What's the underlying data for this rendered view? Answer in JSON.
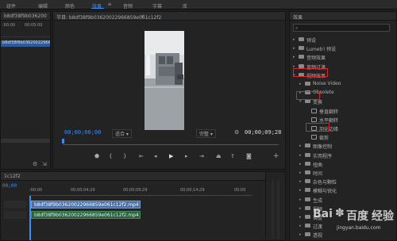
{
  "menu": {
    "items": [
      "组件",
      "编辑",
      "颜色",
      "效果",
      "音频",
      "字幕",
      "库"
    ],
    "active_index": 3
  },
  "project_panel": {
    "title": "b8df38f9b036200",
    "ruler_start": ":00:00",
    "ruler_end": "00:05:00",
    "clip_name": "b8df38f9b03620022966859e061c12f2.mp4"
  },
  "program": {
    "title": "节目: b8df38f9b03620022966859e061c12f2",
    "timecode_left": "00;00;00;00",
    "fit_label": "适合",
    "resolution_label": "完整",
    "timecode_right": "00;00;09;28"
  },
  "timeline": {
    "seq_name": "1c12f2",
    "timecode": "00;00",
    "ruler_labels": [
      ":00;00",
      "00;00;04;29",
      "00;00;09;29",
      "00;00;14;29",
      "00;00"
    ],
    "clip_name": "b8df38f9b03620022966859e061c12f2.mp4 [V]",
    "audio_clip_name": "b8df38f9b03620022966859e061c12f2.mp4"
  },
  "effects_panel": {
    "title": "效果",
    "search_placeholder": "",
    "items": [
      {
        "label": "预设",
        "indent": 0,
        "type": "folder",
        "expanded": false
      },
      {
        "label": "Lumetri 预设",
        "indent": 0,
        "type": "folder",
        "expanded": false
      },
      {
        "label": "音频效果",
        "indent": 0,
        "type": "folder",
        "expanded": false
      },
      {
        "label": "音频过渡",
        "indent": 0,
        "type": "folder",
        "expanded": false
      },
      {
        "label": "视频效果",
        "indent": 0,
        "type": "folder",
        "expanded": true
      },
      {
        "label": "Noise Video",
        "indent": 1,
        "type": "folder",
        "expanded": false
      },
      {
        "label": "Obsolete",
        "indent": 1,
        "type": "folder",
        "expanded": false
      },
      {
        "label": "变换",
        "indent": 1,
        "type": "folder",
        "expanded": true
      },
      {
        "label": "垂直翻转",
        "indent": 2,
        "type": "effect"
      },
      {
        "label": "水平翻转",
        "indent": 2,
        "type": "effect"
      },
      {
        "label": "羽化边缘",
        "indent": 2,
        "type": "effect"
      },
      {
        "label": "裁剪",
        "indent": 2,
        "type": "effect"
      },
      {
        "label": "图像控制",
        "indent": 1,
        "type": "folder",
        "expanded": false
      },
      {
        "label": "实用程序",
        "indent": 1,
        "type": "folder",
        "expanded": false
      },
      {
        "label": "扭曲",
        "indent": 1,
        "type": "folder",
        "expanded": false
      },
      {
        "label": "时间",
        "indent": 1,
        "type": "folder",
        "expanded": false
      },
      {
        "label": "杂色与颗粒",
        "indent": 1,
        "type": "folder",
        "expanded": false
      },
      {
        "label": "模糊与锐化",
        "indent": 1,
        "type": "folder",
        "expanded": false
      },
      {
        "label": "生成",
        "indent": 1,
        "type": "folder",
        "expanded": false
      },
      {
        "label": "视频",
        "indent": 1,
        "type": "folder",
        "expanded": false
      },
      {
        "label": "调整",
        "indent": 1,
        "type": "folder",
        "expanded": false
      },
      {
        "label": "过渡",
        "indent": 1,
        "type": "folder",
        "expanded": false
      },
      {
        "label": "透视",
        "indent": 1,
        "type": "folder",
        "expanded": false
      }
    ]
  },
  "watermark": {
    "brand": "Bai",
    "brand_cn": "百度",
    "text": "经验",
    "url": "jingyan.baidu.com"
  },
  "colors": {
    "accent": "#3d8df5",
    "highlight": "#e0242c",
    "clip": "#4b6fa3"
  }
}
